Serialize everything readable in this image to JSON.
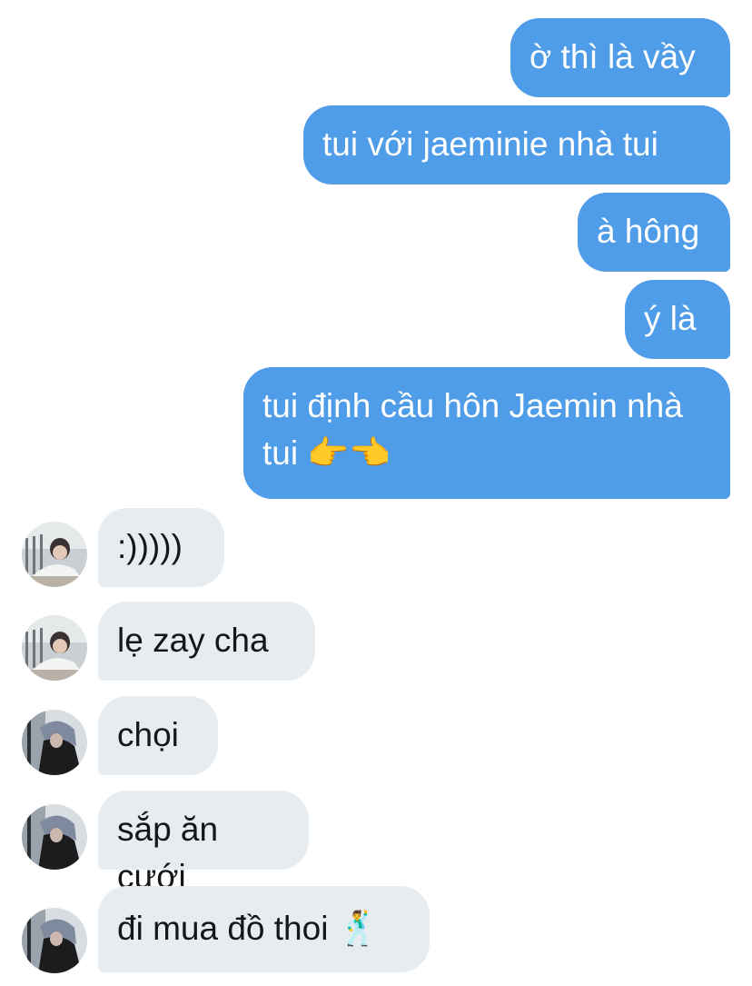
{
  "conversation": {
    "outgoing": [
      {
        "text": "ờ thì là vầy"
      },
      {
        "text": "tui với jaeminie nhà tui"
      },
      {
        "text": "à hông"
      },
      {
        "text": "ý là"
      },
      {
        "text": "tui định cầu hôn Jaemin nhà tui 👉👈"
      }
    ],
    "incoming": [
      {
        "text": ":)))))",
        "avatar": "avatar-user-a"
      },
      {
        "text": "lẹ zay cha",
        "avatar": "avatar-user-a"
      },
      {
        "text": "chọi",
        "avatar": "avatar-user-b"
      },
      {
        "text": "sắp ăn cưới",
        "avatar": "avatar-user-b"
      },
      {
        "text": "đi mua đồ thoi 🕺",
        "avatar": "avatar-user-b"
      }
    ]
  },
  "colors": {
    "outgoing_bubble": "#4f9de8",
    "incoming_bubble": "#e7ecf0",
    "outgoing_text": "#ffffff",
    "incoming_text": "#14171a"
  }
}
